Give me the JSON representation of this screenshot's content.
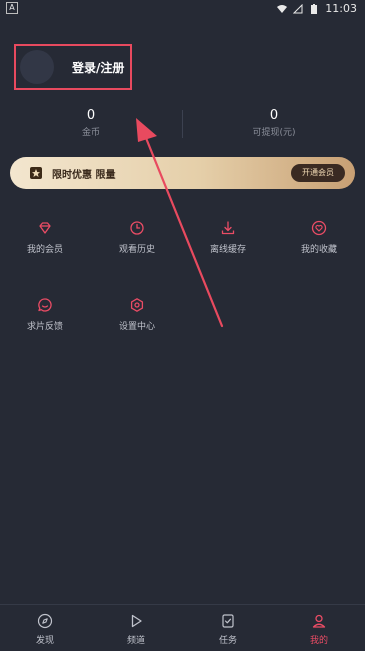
{
  "status_bar": {
    "left_indicator": "A",
    "time": "11:03",
    "icons": [
      "wifi-icon",
      "signal-icon",
      "battery-icon"
    ]
  },
  "profile": {
    "login_label": "登录/注册"
  },
  "stats": {
    "coins": {
      "value": "0",
      "label": "金币"
    },
    "cash": {
      "value": "0",
      "label": "可提现(元)"
    }
  },
  "vip_banner": {
    "text": "限时优惠 限量",
    "button_label": "开通会员",
    "colors": {
      "gradient_start": "#f3e6cf",
      "gradient_end": "#c8a074",
      "button_bg": "#3a2a22"
    }
  },
  "grid": {
    "items": [
      {
        "label": "我的会员",
        "icon": "diamond-icon"
      },
      {
        "label": "观看历史",
        "icon": "clock-icon"
      },
      {
        "label": "离线缓存",
        "icon": "download-icon"
      },
      {
        "label": "我的收藏",
        "icon": "heart-icon"
      },
      {
        "label": "求片反馈",
        "icon": "chat-icon"
      },
      {
        "label": "设置中心",
        "icon": "gear-icon"
      }
    ]
  },
  "bottom_nav": {
    "items": [
      {
        "label": "发现",
        "icon": "compass-icon",
        "active": false
      },
      {
        "label": "频道",
        "icon": "play-icon",
        "active": false
      },
      {
        "label": "任务",
        "icon": "task-icon",
        "active": false
      },
      {
        "label": "我的",
        "icon": "user-icon",
        "active": true
      }
    ]
  },
  "colors": {
    "background": "#262a35",
    "accent": "#ea4c65",
    "annotation": "#e84a5f"
  }
}
